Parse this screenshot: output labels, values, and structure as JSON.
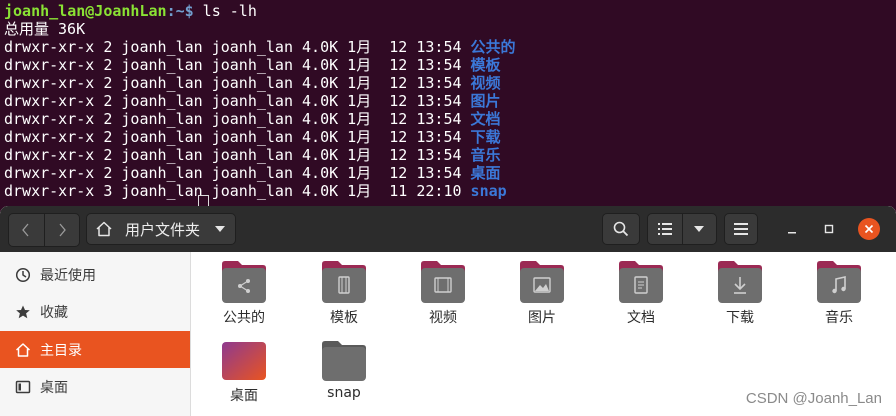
{
  "terminal": {
    "prompt_user": "joanh_lan@JoanhLan",
    "prompt_sep": ":~$",
    "command": " ls -lh",
    "total": "总用量 36K",
    "listing": [
      {
        "meta": "drwxr-xr-x 2 joanh_lan joanh_lan 4.0K 1月  12 13:54 ",
        "name": "公共的"
      },
      {
        "meta": "drwxr-xr-x 2 joanh_lan joanh_lan 4.0K 1月  12 13:54 ",
        "name": "模板"
      },
      {
        "meta": "drwxr-xr-x 2 joanh_lan joanh_lan 4.0K 1月  12 13:54 ",
        "name": "视频"
      },
      {
        "meta": "drwxr-xr-x 2 joanh_lan joanh_lan 4.0K 1月  12 13:54 ",
        "name": "图片"
      },
      {
        "meta": "drwxr-xr-x 2 joanh_lan joanh_lan 4.0K 1月  12 13:54 ",
        "name": "文档"
      },
      {
        "meta": "drwxr-xr-x 2 joanh_lan joanh_lan 4.0K 1月  12 13:54 ",
        "name": "下载"
      },
      {
        "meta": "drwxr-xr-x 2 joanh_lan joanh_lan 4.0K 1月  12 13:54 ",
        "name": "音乐"
      },
      {
        "meta": "drwxr-xr-x 2 joanh_lan joanh_lan 4.0K 1月  12 13:54 ",
        "name": "桌面"
      },
      {
        "meta": "drwxr-xr-x 3 joanh_lan joanh_lan 4.0K 1月  11 22:10 ",
        "name": "snap"
      }
    ]
  },
  "file_manager": {
    "location": "用户文件夹",
    "sidebar": [
      {
        "label": "最近使用",
        "icon": "clock-icon"
      },
      {
        "label": "收藏",
        "icon": "star-icon"
      },
      {
        "label": "主目录",
        "icon": "home-icon",
        "active": true
      },
      {
        "label": "桌面",
        "icon": "desktop-icon"
      }
    ],
    "files": [
      {
        "label": "公共的",
        "emblem": "share-icon"
      },
      {
        "label": "模板",
        "emblem": "template-icon"
      },
      {
        "label": "视频",
        "emblem": "video-icon"
      },
      {
        "label": "图片",
        "emblem": "picture-icon"
      },
      {
        "label": "文档",
        "emblem": "document-icon"
      },
      {
        "label": "下载",
        "emblem": "download-icon"
      },
      {
        "label": "音乐",
        "emblem": "music-icon"
      },
      {
        "label": "桌面",
        "emblem": "desktop-folder-icon"
      },
      {
        "label": "snap",
        "emblem": "folder-icon"
      }
    ]
  },
  "watermark": "CSDN @Joanh_Lan",
  "colors": {
    "terminal_bg": "#300a24",
    "prompt_user": "#8ae234",
    "prompt_path": "#729fcf",
    "dir_name": "#3b78d8",
    "accent": "#e95420",
    "folder_body": "#6e6e6e",
    "folder_tab": "#9b2a54"
  }
}
